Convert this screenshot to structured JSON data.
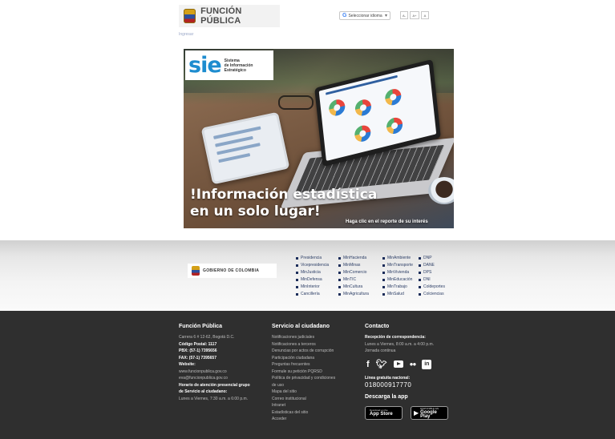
{
  "header": {
    "logo_text": "FUNCIÓN PÚBLICA",
    "language_select": "Seleccionar idioma",
    "font_controls": [
      "A-",
      "A+",
      "A"
    ],
    "skip_link": "Ingresar"
  },
  "hero": {
    "sie_logo": "sie",
    "sie_desc": [
      "Sistema",
      "de Información",
      "Estratégico"
    ],
    "headline_line1": "!Información  estadística",
    "headline_line2": "en un solo lugar!",
    "cta": "Haga clic en el reporte de su interés"
  },
  "gov_band": {
    "logo_text": "GOBIERNO DE COLOMBIA",
    "columns": [
      [
        "Presidencia",
        "Vicepresidencia",
        "MinJusticia",
        "MinDefensa",
        "MinInterior",
        "Cancillería"
      ],
      [
        "MinHacienda",
        "MinMinas",
        "MinComercio",
        "MinTIC",
        "MinCultura",
        "MinAgricultura"
      ],
      [
        "MinAmbiente",
        "MinTransporte",
        "MinVivienda",
        "MinEducación",
        "MinTrabajo",
        "MinSalud"
      ],
      [
        "DNP",
        "DANE",
        "DPS",
        "DNI",
        "Coldeportes",
        "Colciencias"
      ]
    ]
  },
  "footer": {
    "col1": {
      "title": "Función Pública",
      "lines": [
        "Carrera 6 # 12-62, Bogotá D.C.",
        "Código Postal: 1117",
        "PBX: (57-1) 7395656",
        "FAX: (57-1) 7395657",
        "Website:",
        "www.funcionpublica.gov.co",
        "eva@funcionpublica.gov.co",
        "Horario de atención presencial grupo",
        "de Servicio al ciudadano:",
        "Lunes a Viernes, 7:30 a.m. a 6:00 p.m."
      ]
    },
    "col2": {
      "title": "Servicio al ciudadano",
      "links": [
        "Notificaciones judiciales",
        "Notificaciones a terceros",
        "Denuncias por actos de corrupción",
        "Participación ciudadana",
        "Preguntas frecuentes",
        "Formule su petición PQRSD",
        "Política de privacidad y condiciones",
        "de uso",
        "Mapa del sitio",
        "Correo institucional",
        "Intranet",
        "Estadísticas del sitio",
        "Acceder"
      ]
    },
    "col3": {
      "title": "Contacto",
      "reception_label": "Recepción de correspondencia:",
      "reception_lines": [
        "Lunes a Viernes, 8:00 a.m. a 4:00 p.m.",
        "Jornada continua"
      ],
      "social": [
        "facebook-icon",
        "twitter-icon",
        "youtube-icon",
        "flickr-icon",
        "linkedin-icon"
      ],
      "hotline_label": "Línea gratuita nacional:",
      "hotline": "018000917770",
      "app_title": "Descarga la app",
      "app_store": {
        "small": "Download on the",
        "big": "App Store"
      },
      "google_play": {
        "small": "DISPONIBLE EN",
        "big": "Google Play"
      }
    }
  }
}
